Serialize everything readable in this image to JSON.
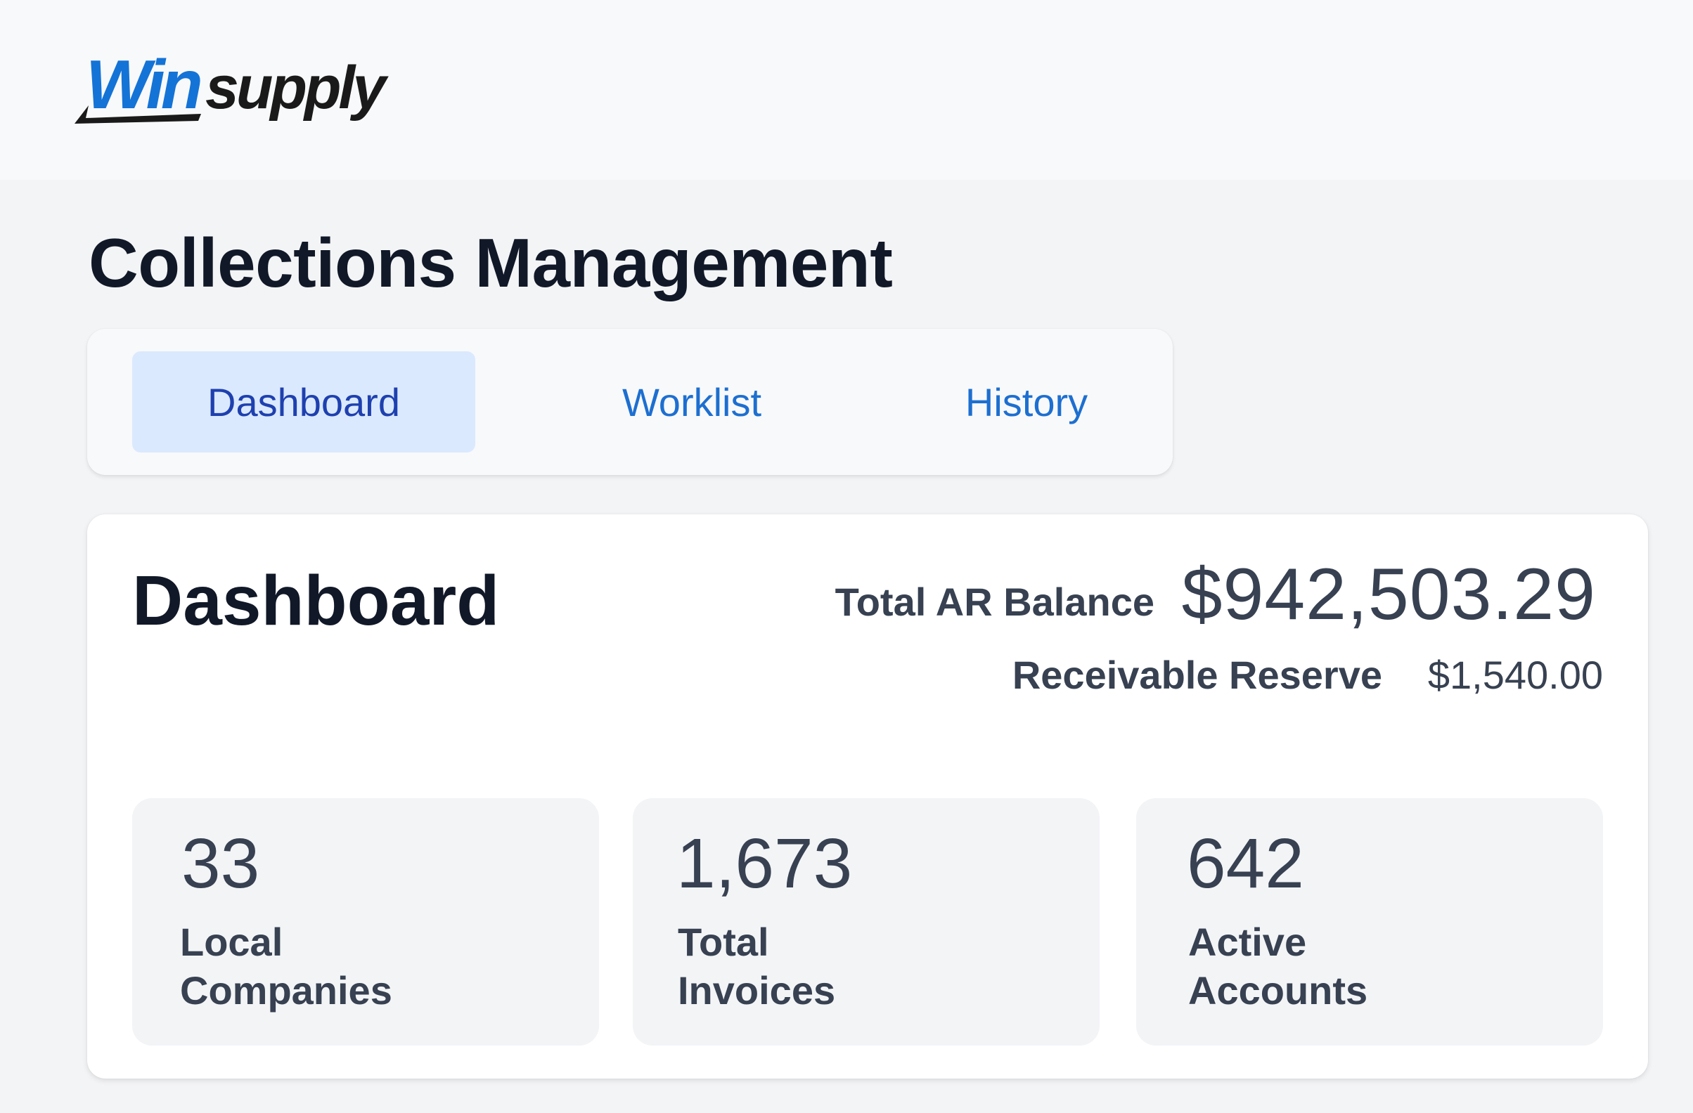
{
  "brand": {
    "logo_part1": "Win",
    "logo_part2": "supply",
    "logo_colors": {
      "blue": "#1473d6",
      "black": "#1a1a1a"
    }
  },
  "page": {
    "title": "Collections Management"
  },
  "tabs": [
    {
      "label": "Dashboard",
      "active": true
    },
    {
      "label": "Worklist",
      "active": false
    },
    {
      "label": "History",
      "active": false
    }
  ],
  "dashboard": {
    "title": "Dashboard",
    "total_ar_label": "Total AR Balance",
    "total_ar_value": "$942,503.29",
    "reserve_label": "Receivable Reserve",
    "reserve_value": "$1,540.00",
    "stats": [
      {
        "value": "33",
        "label_line1": "Local",
        "label_line2": "Companies"
      },
      {
        "value": "1,673",
        "label_line1": "Total",
        "label_line2": "Invoices"
      },
      {
        "value": "642",
        "label_line1": "Active",
        "label_line2": "Accounts"
      }
    ]
  },
  "colors": {
    "accent": "#1d6fd0",
    "active_tab_bg": "#dbe9fe",
    "active_tab_text": "#1e40af",
    "page_bg": "#f3f4f6"
  }
}
